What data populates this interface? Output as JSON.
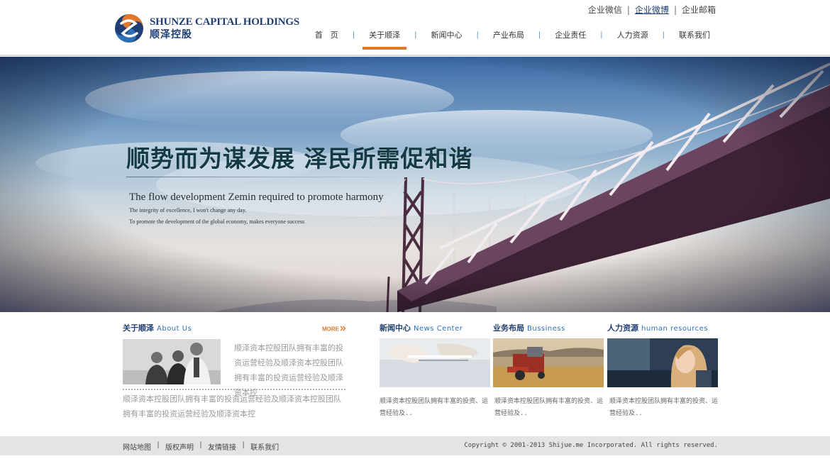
{
  "brand": {
    "name_en": "SHUNZE CAPITAL HOLDINGS",
    "name_cn": "顺泽控股"
  },
  "top_links": [
    {
      "label": "企业微信"
    },
    {
      "label": "企业微博"
    },
    {
      "label": "企业邮箱"
    }
  ],
  "nav": {
    "items": [
      {
        "label": "首　页"
      },
      {
        "label": "关于顺泽"
      },
      {
        "label": "新闻中心"
      },
      {
        "label": "产业布局"
      },
      {
        "label": "企业责任"
      },
      {
        "label": "人力资源"
      },
      {
        "label": "联系我们"
      }
    ],
    "separator": "|",
    "active_index": 1
  },
  "banner": {
    "headline_cn": "顺势而为谋发展  泽民所需促和谐",
    "headline_en": "The flow development Zemin required to promote harmony",
    "sub1": "The integrity of excellence, I won't change any day.",
    "sub2": "To promote the development of the global economy, makes everyone success"
  },
  "about": {
    "title_cn": "关于顺泽",
    "title_en": "About Us",
    "more_label": "MORE",
    "text_short": "顺泽资本控股团队拥有丰富的投资运营经验及顺泽资本控股团队拥有丰富的投资运营经验及顺泽资本控",
    "text_long": "顺泽资本控股团队拥有丰富的投资运营经验及顺泽资本控股团队拥有丰富的投资运营经验及顺泽资本控"
  },
  "cards": [
    {
      "title_cn": "新闻中心",
      "title_en": "News Center",
      "text": "顺泽资本控股团队拥有丰富的投资、运营经验及.."
    },
    {
      "title_cn": "业务布局",
      "title_en": "Bussiness",
      "text": "顺泽资本控股团队拥有丰富的投资、运营经验及.."
    },
    {
      "title_cn": "人力资源",
      "title_en": "human resources",
      "text": "顺泽资本控股团队拥有丰富的投资、运营经验及.."
    }
  ],
  "footer": {
    "links": [
      {
        "label": "网站地图"
      },
      {
        "label": "版权声明"
      },
      {
        "label": "友情链接"
      },
      {
        "label": "联系我们"
      }
    ],
    "separator": "|",
    "copyright": "Copyright © 2001-2013 Shijue.me Incorporated. All rights reserved."
  },
  "colors": {
    "brand_blue": "#1f3e73",
    "accent_orange": "#e0772b",
    "link_blue": "#2f6fb5",
    "footer_bg": "#e4e4e4"
  }
}
